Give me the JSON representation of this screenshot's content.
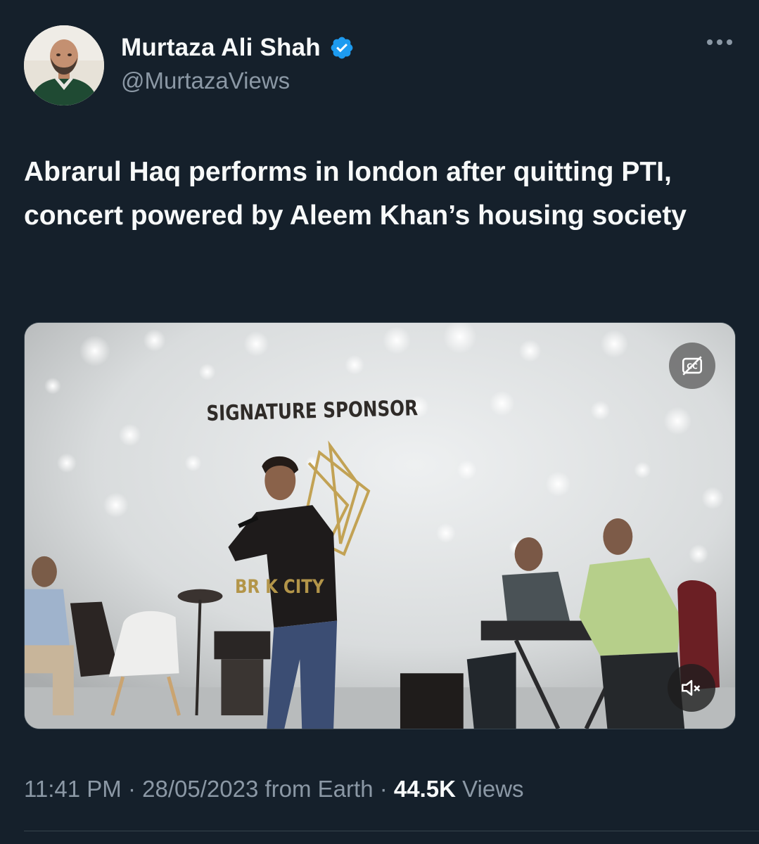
{
  "author": {
    "display_name": "Murtaza Ali Shah",
    "handle": "@MurtazaViews",
    "verified": true,
    "verified_color": "#1d9bf0"
  },
  "tweet": {
    "text": "Abrarul Haq performs in london after quitting PTI, concert powered by Aleem Khan’s housing society"
  },
  "media": {
    "type": "video",
    "scene_text": {
      "banner": "SIGNATURE SPONSOR",
      "logo_partial": "BR      K CITY"
    },
    "controls": {
      "captions_icon": "closed-captions-off-icon",
      "mute_icon": "volume-muted-icon"
    }
  },
  "meta": {
    "time": "11:41 PM",
    "separator": "·",
    "date": "28/05/2023",
    "source": "from Earth",
    "views_count": "44.5K",
    "views_label": "Views"
  },
  "colors": {
    "background": "#15202b",
    "primary_text": "#f7f9f9",
    "secondary_text": "#8b98a5",
    "border": "#38444d"
  }
}
